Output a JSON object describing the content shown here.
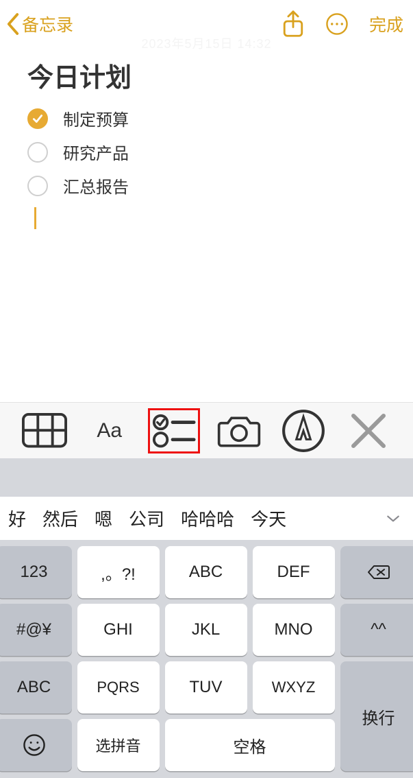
{
  "header": {
    "back_label": "备忘录",
    "done_label": "完成",
    "timestamp": "2023年5月15日 14:32"
  },
  "note": {
    "title": "今日计划",
    "items": [
      {
        "text": "制定预算",
        "checked": true
      },
      {
        "text": "研究产品",
        "checked": false
      },
      {
        "text": "汇总报告",
        "checked": false
      }
    ]
  },
  "toolbar": {
    "format_label": "Aa"
  },
  "suggestions": {
    "items": [
      "好",
      "然后",
      "嗯",
      "公司",
      "哈哈哈",
      "今天"
    ]
  },
  "keyboard": {
    "k_123": "123",
    "k_punct": ",。?!",
    "k_abc": "ABC",
    "k_def": "DEF",
    "k_sym": "#@¥",
    "k_ghi": "GHI",
    "k_jkl": "JKL",
    "k_mno": "MNO",
    "k_face": "^^",
    "k_abc2": "ABC",
    "k_pqrs": "PQRS",
    "k_tuv": "TUV",
    "k_wxyz": "WXYZ",
    "k_return": "换行",
    "k_pinyin": "选拼音",
    "k_space": "空格"
  }
}
